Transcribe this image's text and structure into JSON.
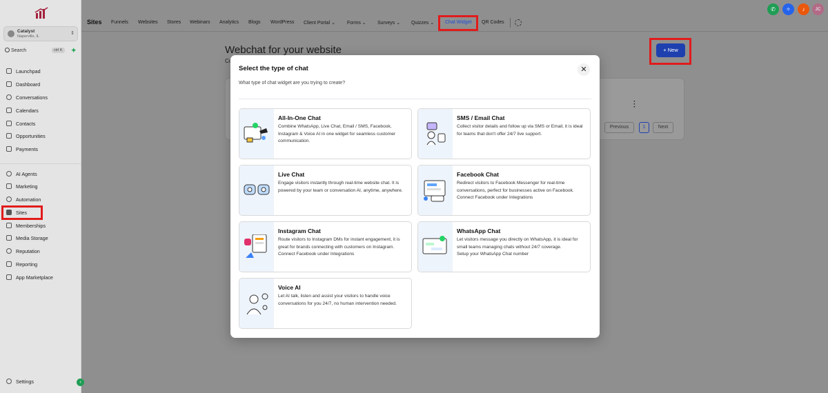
{
  "sidebar": {
    "account": {
      "name": "Catalyst",
      "location": "Naperville, IL"
    },
    "search": {
      "label": "Search",
      "shortcut": "ctrl K"
    },
    "items": [
      {
        "label": "Launchpad"
      },
      {
        "label": "Dashboard"
      },
      {
        "label": "Conversations"
      },
      {
        "label": "Calendars"
      },
      {
        "label": "Contacts"
      },
      {
        "label": "Opportunities"
      },
      {
        "label": "Payments"
      },
      {
        "label": "AI Agents"
      },
      {
        "label": "Marketing"
      },
      {
        "label": "Automation"
      },
      {
        "label": "Sites"
      },
      {
        "label": "Memberships"
      },
      {
        "label": "Media Storage"
      },
      {
        "label": "Reputation"
      },
      {
        "label": "Reporting"
      },
      {
        "label": "App Marketplace"
      }
    ],
    "settings": {
      "label": "Settings"
    }
  },
  "topbar": {
    "title": "Sites",
    "tabs": [
      {
        "label": "Funnels"
      },
      {
        "label": "Websites"
      },
      {
        "label": "Stores"
      },
      {
        "label": "Webinars"
      },
      {
        "label": "Analytics"
      },
      {
        "label": "Blogs"
      },
      {
        "label": "WordPress"
      },
      {
        "label": "Client Portal"
      },
      {
        "label": "Forms"
      },
      {
        "label": "Surveys"
      },
      {
        "label": "Quizzes"
      },
      {
        "label": "Chat Widget"
      },
      {
        "label": "QR Codes"
      }
    ],
    "avatar_initials": "JC",
    "colors": {
      "phone": "#1f9d55",
      "spark": "#2563eb",
      "bell": "#ea580c",
      "avatar": "#b26b86"
    }
  },
  "page": {
    "title": "Webchat for your website",
    "subtitle": "Co",
    "new_button": "+ New",
    "pagination": {
      "previous": "Previous",
      "current": "1",
      "next": "Next"
    }
  },
  "modal": {
    "title": "Select the type of chat",
    "subtitle": "What type of chat widget are you trying to create?",
    "close": "✕",
    "options": [
      {
        "title": "All-In-One Chat",
        "desc": "Combine WhatsApp, Live Chat, Email / SMS, Facebook, Instagram & Voice AI in one widget for seamless customer communication.",
        "extra": ""
      },
      {
        "title": "SMS / Email Chat",
        "desc": "Collect visitor details and follow up via SMS or Email, it is ideal for teams that don't offer 24/7 live support.",
        "extra": ""
      },
      {
        "title": "Live Chat",
        "desc": "Engage visitors instantly through real-time website chat. It is powered by your team or conversation AI, anytime, anywhere.",
        "extra": ""
      },
      {
        "title": "Facebook Chat",
        "desc": "Redirect visitors to Facebook Messenger for real-time conversations, perfect for businesses active on Facebook.",
        "extra": "Connect Facebook under Integrations"
      },
      {
        "title": "Instagram Chat",
        "desc": "Route visitors to Instagram DMs for instant engagement, it is great for brands connecting with customers on Instagram.",
        "extra": "Connect Facebook under Integrations"
      },
      {
        "title": "WhatsApp Chat",
        "desc": "Let visitors message you directly on WhatsApp, it is ideal for small teams managing chats without 24/7 coverage.",
        "extra": "Setup your WhatsApp Chat number"
      },
      {
        "title": "Voice AI",
        "desc": "Let AI talk, listen and assist your visitors to handle voice conversations for you 24/7, no human intervention needed.",
        "extra": ""
      }
    ]
  }
}
